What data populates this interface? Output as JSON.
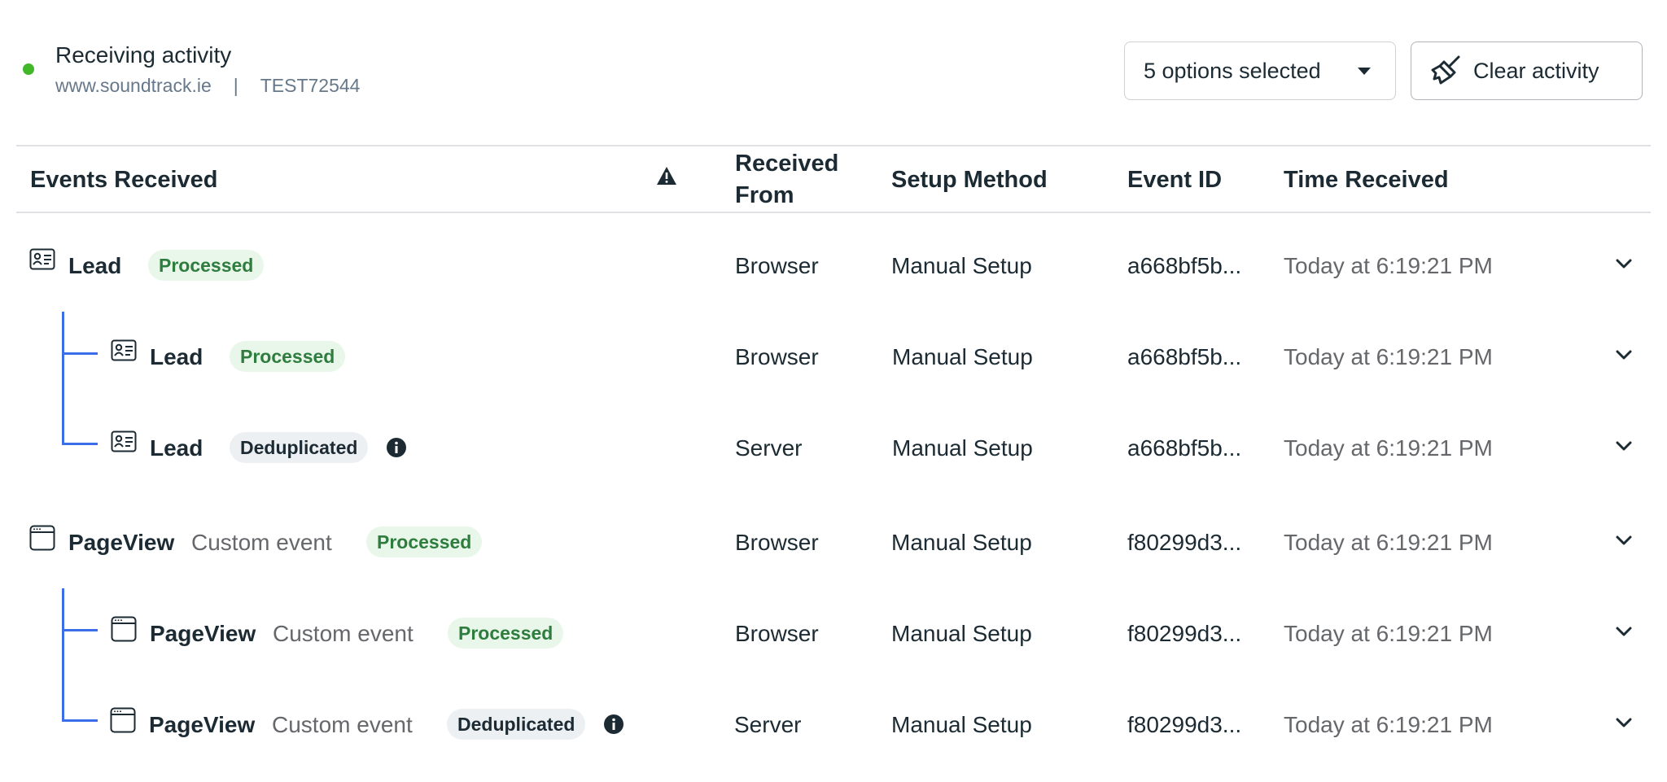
{
  "status": {
    "title": "Receiving activity",
    "domain": "www.soundtrack.ie",
    "separator": "|",
    "pixel_id": "TEST72544",
    "dot_color": "#42b72a"
  },
  "toolbar": {
    "options_label": "5 options selected",
    "clear_label": "Clear activity"
  },
  "table": {
    "headers": {
      "events": "Events Received",
      "received_from_line1": "Received",
      "received_from_line2": "From",
      "setup_method": "Setup Method",
      "event_id": "Event ID",
      "time_received": "Time Received"
    },
    "rows": [
      {
        "name": "Lead",
        "custom": "",
        "status": "Processed",
        "from": "Browser",
        "setup": "Manual Setup",
        "event_id": "a668bf5b...",
        "time": "Today at 6:19:21 PM"
      },
      {
        "name": "Lead",
        "custom": "",
        "status": "Processed",
        "from": "Browser",
        "setup": "Manual Setup",
        "event_id": "a668bf5b...",
        "time": "Today at 6:19:21 PM"
      },
      {
        "name": "Lead",
        "custom": "",
        "status": "Deduplicated",
        "from": "Server",
        "setup": "Manual Setup",
        "event_id": "a668bf5b...",
        "time": "Today at 6:19:21 PM"
      },
      {
        "name": "PageView",
        "custom": "Custom event",
        "status": "Processed",
        "from": "Browser",
        "setup": "Manual Setup",
        "event_id": "f80299d3...",
        "time": "Today at 6:19:21 PM"
      },
      {
        "name": "PageView",
        "custom": "Custom event",
        "status": "Processed",
        "from": "Browser",
        "setup": "Manual Setup",
        "event_id": "f80299d3...",
        "time": "Today at 6:19:21 PM"
      },
      {
        "name": "PageView",
        "custom": "Custom event",
        "status": "Deduplicated",
        "from": "Server",
        "setup": "Manual Setup",
        "event_id": "f80299d3...",
        "time": "Today at 6:19:21 PM"
      }
    ]
  },
  "colors": {
    "tree_line": "#3b6ee8",
    "processed_bg": "#e9f6ea",
    "processed_text": "#2e7d3e",
    "dedup_bg": "#edf0f3"
  },
  "icons": {
    "lead": "contact-card-icon",
    "pageview": "browser-window-icon",
    "warning": "warning-icon",
    "info": "info-icon",
    "expand": "chevron-down-icon",
    "clear": "broom-icon",
    "dropdown": "caret-down-icon"
  }
}
